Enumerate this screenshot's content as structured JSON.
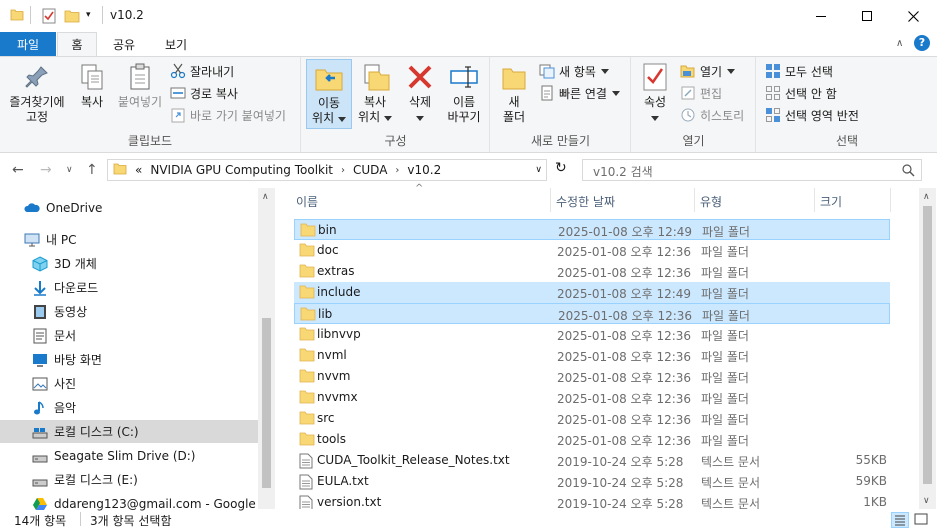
{
  "window": {
    "title": "v10.2",
    "minimize_glyph": "—",
    "maximize_glyph": "☐",
    "close_glyph": "✕"
  },
  "ribbon_tabs": [
    "파일",
    "홈",
    "공유",
    "보기"
  ],
  "ribbon": {
    "clipboard": {
      "pin_label": "즐겨찾기에\n고정",
      "copy_label": "복사",
      "paste_label": "붙여넣기",
      "cut_label": "잘라내기",
      "copy_path_label": "경로 복사",
      "paste_shortcut_label": "바로 가기 붙여넣기",
      "group_label": "클립보드"
    },
    "organize": {
      "move_label_1": "이동",
      "move_label_2": "위치",
      "copyto_label_1": "복사",
      "copyto_label_2": "위치",
      "delete_label": "삭제",
      "rename_label_1": "이름",
      "rename_label_2": "바꾸기",
      "group_label": "구성"
    },
    "new": {
      "new_folder_label_1": "새",
      "new_folder_label_2": "폴더",
      "new_item_label": "새 항목",
      "easy_access_label": "빠른 연결",
      "group_label": "새로 만들기"
    },
    "open": {
      "properties_label": "속성",
      "open_label": "열기",
      "edit_label": "편집",
      "history_label": "히스토리",
      "group_label": "열기"
    },
    "select": {
      "select_all_label": "모두 선택",
      "select_none_label": "선택 안 함",
      "invert_label": "선택 영역 반전",
      "group_label": "선택"
    }
  },
  "address": {
    "overflow": "«",
    "segments": [
      "NVIDIA GPU Computing Toolkit",
      "CUDA",
      "v10.2"
    ],
    "search_placeholder": "v10.2 검색"
  },
  "nav_pane": {
    "items": [
      {
        "label": "OneDrive",
        "icon": "cloud-icon"
      },
      {
        "label": "내 PC",
        "icon": "pc-icon"
      },
      {
        "label": "3D 개체",
        "icon": "cube-icon"
      },
      {
        "label": "다운로드",
        "icon": "download-icon"
      },
      {
        "label": "동영상",
        "icon": "video-icon"
      },
      {
        "label": "문서",
        "icon": "document-icon"
      },
      {
        "label": "바탕 화면",
        "icon": "desktop-icon"
      },
      {
        "label": "사진",
        "icon": "picture-icon"
      },
      {
        "label": "음악",
        "icon": "music-icon"
      },
      {
        "label": "로컬 디스크 (C:)",
        "icon": "drive-icon"
      },
      {
        "label": "Seagate Slim Drive (D:)",
        "icon": "drive-icon"
      },
      {
        "label": "로컬 디스크 (E:)",
        "icon": "drive-icon"
      },
      {
        "label": "ddareng123@gmail.com - Google",
        "icon": "google-drive-icon"
      }
    ]
  },
  "columns": {
    "name": "이름",
    "date": "수정한 날짜",
    "type": "유형",
    "size": "크기"
  },
  "files": [
    {
      "name": "bin",
      "date": "2025-01-08 오후 12:49",
      "type": "파일 폴더",
      "size": "",
      "kind": "folder",
      "selected": true
    },
    {
      "name": "doc",
      "date": "2025-01-08 오후 12:36",
      "type": "파일 폴더",
      "size": "",
      "kind": "folder",
      "selected": false
    },
    {
      "name": "extras",
      "date": "2025-01-08 오후 12:36",
      "type": "파일 폴더",
      "size": "",
      "kind": "folder",
      "selected": false
    },
    {
      "name": "include",
      "date": "2025-01-08 오후 12:49",
      "type": "파일 폴더",
      "size": "",
      "kind": "folder",
      "selected": true
    },
    {
      "name": "lib",
      "date": "2025-01-08 오후 12:36",
      "type": "파일 폴더",
      "size": "",
      "kind": "folder",
      "selected": true
    },
    {
      "name": "libnvvp",
      "date": "2025-01-08 오후 12:36",
      "type": "파일 폴더",
      "size": "",
      "kind": "folder",
      "selected": false
    },
    {
      "name": "nvml",
      "date": "2025-01-08 오후 12:36",
      "type": "파일 폴더",
      "size": "",
      "kind": "folder",
      "selected": false
    },
    {
      "name": "nvvm",
      "date": "2025-01-08 오후 12:36",
      "type": "파일 폴더",
      "size": "",
      "kind": "folder",
      "selected": false
    },
    {
      "name": "nvvmx",
      "date": "2025-01-08 오후 12:36",
      "type": "파일 폴더",
      "size": "",
      "kind": "folder",
      "selected": false
    },
    {
      "name": "src",
      "date": "2025-01-08 오후 12:36",
      "type": "파일 폴더",
      "size": "",
      "kind": "folder",
      "selected": false
    },
    {
      "name": "tools",
      "date": "2025-01-08 오후 12:36",
      "type": "파일 폴더",
      "size": "",
      "kind": "folder",
      "selected": false
    },
    {
      "name": "CUDA_Toolkit_Release_Notes.txt",
      "date": "2019-10-24 오후 5:28",
      "type": "텍스트 문서",
      "size": "55KB",
      "kind": "text",
      "selected": false
    },
    {
      "name": "EULA.txt",
      "date": "2019-10-24 오후 5:28",
      "type": "텍스트 문서",
      "size": "59KB",
      "kind": "text",
      "selected": false
    },
    {
      "name": "version.txt",
      "date": "2019-10-24 오후 5:28",
      "type": "텍스트 문서",
      "size": "1KB",
      "kind": "text",
      "selected": false
    }
  ],
  "status": {
    "item_count": "14개 항목",
    "selected_count": "3개 항목 선택함"
  },
  "colors": {
    "accent": "#1979ca",
    "selection": "#cce8ff",
    "folder": "#f8d775"
  }
}
